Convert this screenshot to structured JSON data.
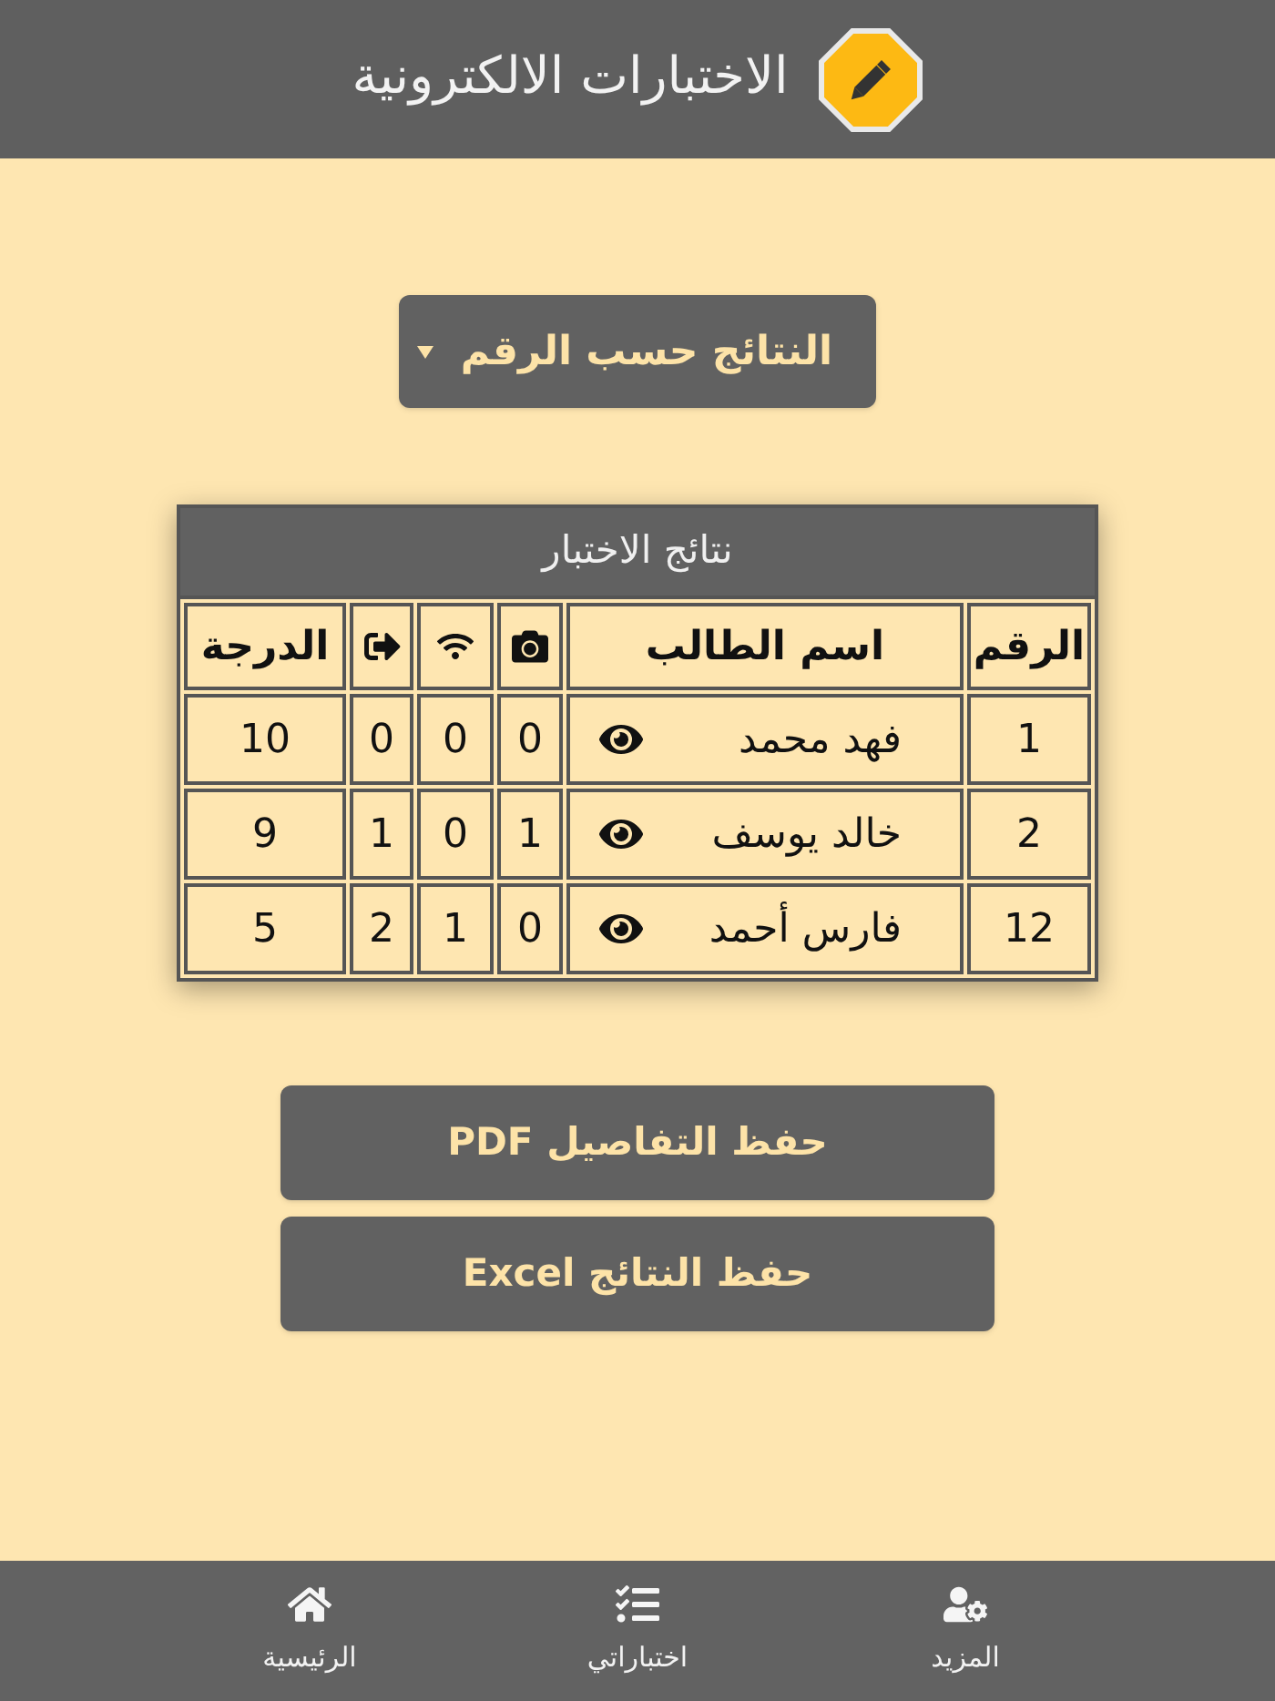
{
  "header": {
    "title": "الاختبارات الالكترونية"
  },
  "sort_dropdown": {
    "value": "النتائج حسب الرقم"
  },
  "results_table": {
    "title": "نتائج الاختبار",
    "columns": [
      {
        "kind": "text",
        "label": "الرقم"
      },
      {
        "kind": "text",
        "label": "اسم الطالب"
      },
      {
        "kind": "icon"
      },
      {
        "kind": "icon"
      },
      {
        "kind": "icon"
      },
      {
        "kind": "text",
        "label": "الدرجة"
      }
    ],
    "rows": [
      {
        "number": "1",
        "name": "فهد محمد",
        "column_3": "0",
        "column_4": "0",
        "column_5": "0",
        "grade": "10"
      },
      {
        "number": "2",
        "name": "خالد يوسف",
        "column_3": "1",
        "column_4": "0",
        "column_5": "1",
        "grade": "9"
      },
      {
        "number": "12",
        "name": "فارس أحمد",
        "column_3": "0",
        "column_4": "1",
        "column_5": "2",
        "grade": "5"
      }
    ]
  },
  "buttons": [
    "حفظ التفاصيل PDF",
    "حفظ النتائج Excel"
  ],
  "bottom_nav": {
    "items": [
      {
        "label": "المزيد"
      },
      {
        "label": "اختباراتي"
      },
      {
        "label": "الرئيسية"
      }
    ]
  }
}
